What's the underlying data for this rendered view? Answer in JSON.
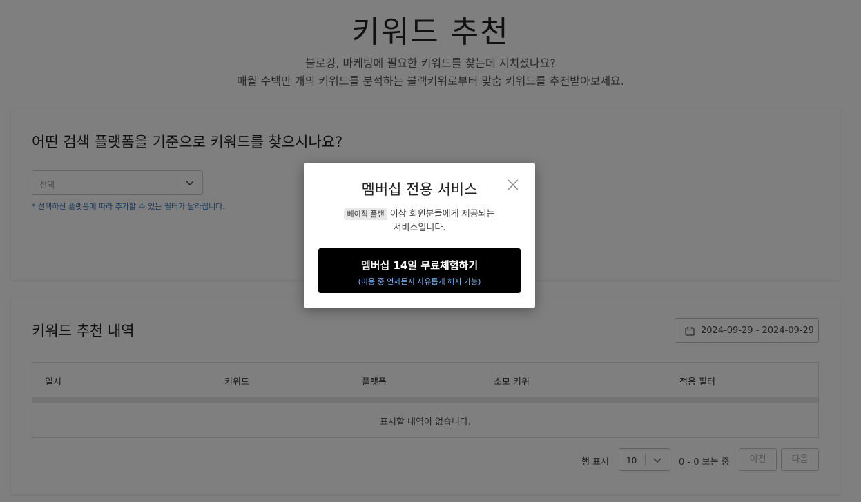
{
  "header": {
    "title": "키워드 추천",
    "subtitle_line1": "블로깅, 마케팅에 필요한 키워드를 찾는데 지치셨나요?",
    "subtitle_line2": "매월 수백만 개의 키워드를 분석하는 블랙키위로부터 맞춤 키워드를 추천받아보세요."
  },
  "platform": {
    "question": "어떤 검색 플랫폼을 기준으로 키워드를 찾으시나요?",
    "select_value": "선택",
    "hint": "* 선택하신 플랫폼에 따라 추가할 수 있는 필터가 달라집니다."
  },
  "history": {
    "title": "키워드 추천 내역",
    "date_range": "2024-09-29 - 2024-09-29",
    "columns": [
      "일시",
      "키워드",
      "플랫폼",
      "소모 키위",
      "적용 필터"
    ],
    "empty_text": "표시할 내역이 없습니다.",
    "rows_label": "행 표시",
    "rows_per_page": "10",
    "range_text": "0 - 0 보는 중",
    "prev_label": "이전",
    "next_label": "다음"
  },
  "modal": {
    "title": "멤버십 전용 서비스",
    "badge": "베이직 플랜",
    "desc_line1_suffix": " 이상 회원분들에게 제공되는",
    "desc_line2": "서비스입니다.",
    "cta_main": "멤버십 14일 무료체험하기",
    "cta_sub": "(이용 중 언제든지 자유롭게 해지 가능)"
  },
  "icons": {
    "select_chevron": "chevron-down-icon",
    "calendar": "calendar-icon",
    "close": "close-icon"
  },
  "colors": {
    "overlay": "#000000",
    "hint_blue": "#2f6fb6",
    "cta_bg": "#000000",
    "cta_sub": "#7db4f5"
  }
}
